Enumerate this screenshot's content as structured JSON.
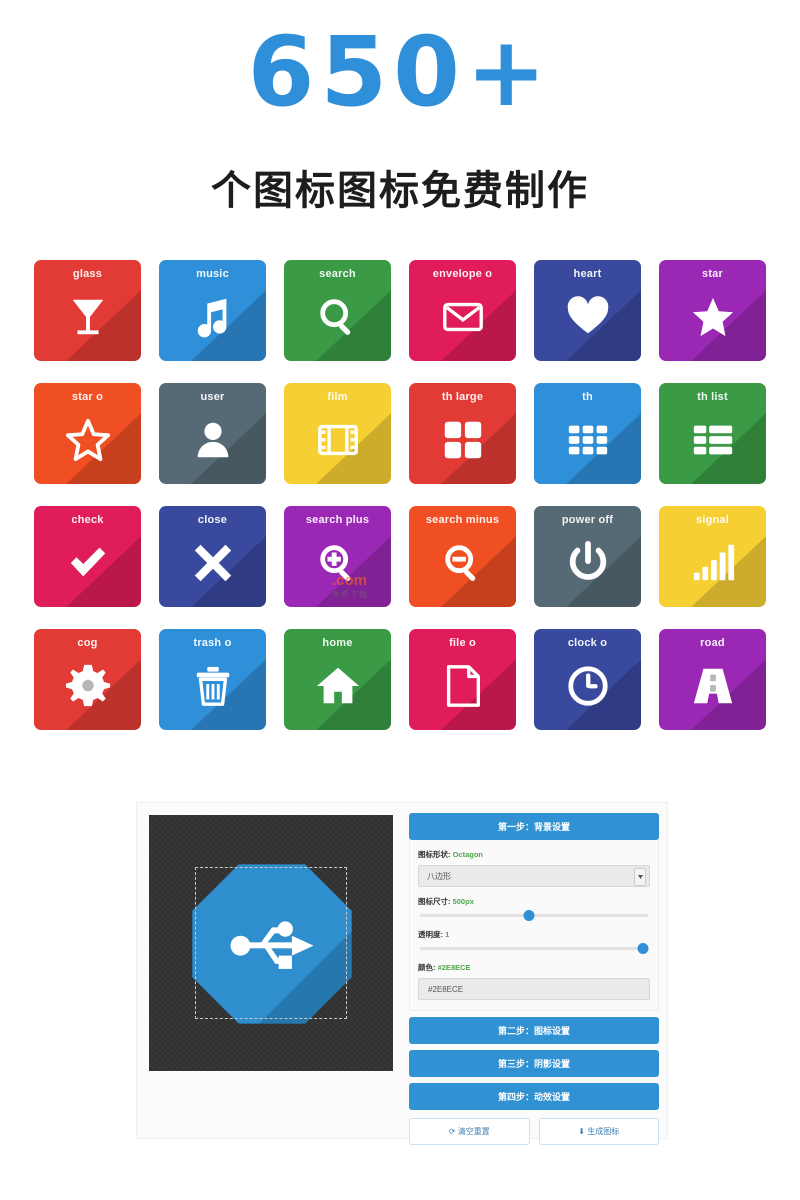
{
  "hero": {
    "number": "650+",
    "subtitle": "个图标图标免费制作"
  },
  "icon_grid": {
    "tiles": [
      {
        "label": "glass",
        "icon": "glass-icon",
        "color": "#e23b36"
      },
      {
        "label": "music",
        "icon": "music-icon",
        "color": "#2f8fd8"
      },
      {
        "label": "search",
        "icon": "search-icon",
        "color": "#3a9a46"
      },
      {
        "label": "envelope o",
        "icon": "envelope-icon",
        "color": "#e01d5a"
      },
      {
        "label": "heart",
        "icon": "heart-icon",
        "color": "#39499e"
      },
      {
        "label": "star",
        "icon": "star-icon",
        "color": "#9b28b5"
      },
      {
        "label": "star o",
        "icon": "star-outline-icon",
        "color": "#f04e23"
      },
      {
        "label": "user",
        "icon": "user-icon",
        "color": "#566a75"
      },
      {
        "label": "film",
        "icon": "film-icon",
        "color": "#f6cf33"
      },
      {
        "label": "th large",
        "icon": "grid-large-icon",
        "color": "#e23b36"
      },
      {
        "label": "th",
        "icon": "grid-icon",
        "color": "#2f8fd8"
      },
      {
        "label": "th list",
        "icon": "list-icon",
        "color": "#3a9a46"
      },
      {
        "label": "check",
        "icon": "check-icon",
        "color": "#e01d5a"
      },
      {
        "label": "close",
        "icon": "close-icon",
        "color": "#39499e"
      },
      {
        "label": "search plus",
        "icon": "zoom-in-icon",
        "color": "#9b28b5"
      },
      {
        "label": "search minus",
        "icon": "zoom-out-icon",
        "color": "#f04e23"
      },
      {
        "label": "power off",
        "icon": "power-icon",
        "color": "#566a75"
      },
      {
        "label": "signal",
        "icon": "signal-icon",
        "color": "#f6cf33"
      },
      {
        "label": "cog",
        "icon": "gear-icon",
        "color": "#e23b36"
      },
      {
        "label": "trash o",
        "icon": "trash-icon",
        "color": "#2f8fd8"
      },
      {
        "label": "home",
        "icon": "home-icon",
        "color": "#3a9a46"
      },
      {
        "label": "file o",
        "icon": "file-icon",
        "color": "#e01d5a"
      },
      {
        "label": "clock o",
        "icon": "clock-icon",
        "color": "#39499e"
      },
      {
        "label": "road",
        "icon": "road-icon",
        "color": "#9b28b5"
      }
    ]
  },
  "watermark": {
    "domain": ".com",
    "sub": "免费下载"
  },
  "app": {
    "preview": {
      "shape_icon": "usb-icon",
      "shape_color": "#2E8ECE"
    },
    "panel": {
      "header": "第一步：背景设置",
      "shape_label": "图标形状:",
      "shape_value": "Octagon",
      "shape_select_value": "八边形",
      "size_label": "图标尺寸:",
      "size_value": "500px",
      "size_slider_percent": 48,
      "opacity_label": "透明度:",
      "opacity_value": "1",
      "opacity_slider_percent": 98,
      "color_label": "颜色:",
      "color_value": "#2E8ECE",
      "color_input_value": "#2E8ECE",
      "steps": [
        "第二步：图标设置",
        "第三步：阴影设置",
        "第四步：动效设置"
      ],
      "reset_button": "⟳ 清空重置",
      "generate_button": "⬇ 生成图标"
    }
  }
}
